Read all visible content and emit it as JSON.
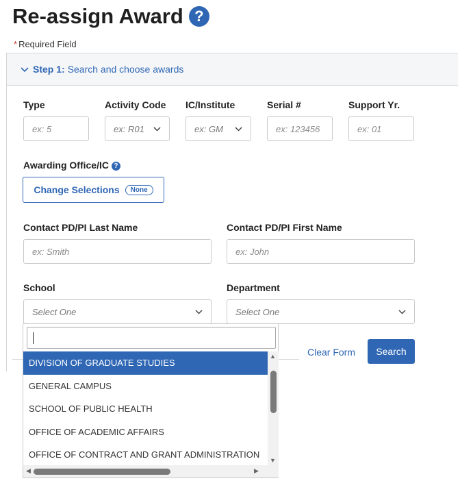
{
  "page": {
    "title": "Re-assign Award",
    "help_glyph": "?"
  },
  "required_note": {
    "star": "*",
    "text": "Required Field"
  },
  "step": {
    "label": "Step 1:",
    "text": "Search and choose awards"
  },
  "fields": {
    "type": {
      "label": "Type",
      "placeholder": "ex: 5"
    },
    "activity_code": {
      "label": "Activity Code",
      "value": "ex: R01"
    },
    "ic_institute": {
      "label": "IC/Institute",
      "value": "ex: GM"
    },
    "serial": {
      "label": "Serial #",
      "placeholder": "ex: 123456"
    },
    "support_yr": {
      "label": "Support Yr.",
      "placeholder": "ex: 01"
    },
    "awarding_office": {
      "label": "Awarding Office/IC"
    },
    "pi_last": {
      "label": "Contact PD/PI Last Name",
      "placeholder": "ex: Smith"
    },
    "pi_first": {
      "label": "Contact PD/PI First Name",
      "placeholder": "ex: John"
    },
    "school": {
      "label": "School",
      "value": "Select One"
    },
    "department": {
      "label": "Department",
      "value": "Select One"
    }
  },
  "change_selections": {
    "label": "Change Selections",
    "badge": "None"
  },
  "actions": {
    "clear": "Clear Form",
    "search": "Search"
  },
  "school_dropdown": {
    "search_value": "",
    "options": [
      "DIVISION OF GRADUATE STUDIES",
      "GENERAL CAMPUS",
      "SCHOOL OF PUBLIC HEALTH",
      "OFFICE OF ACADEMIC AFFAIRS",
      "OFFICE OF CONTRACT AND GRANT ADMINISTRATION"
    ],
    "selected_index": 0
  },
  "colors": {
    "accent": "#2f67b5",
    "required": "#c0392b"
  }
}
